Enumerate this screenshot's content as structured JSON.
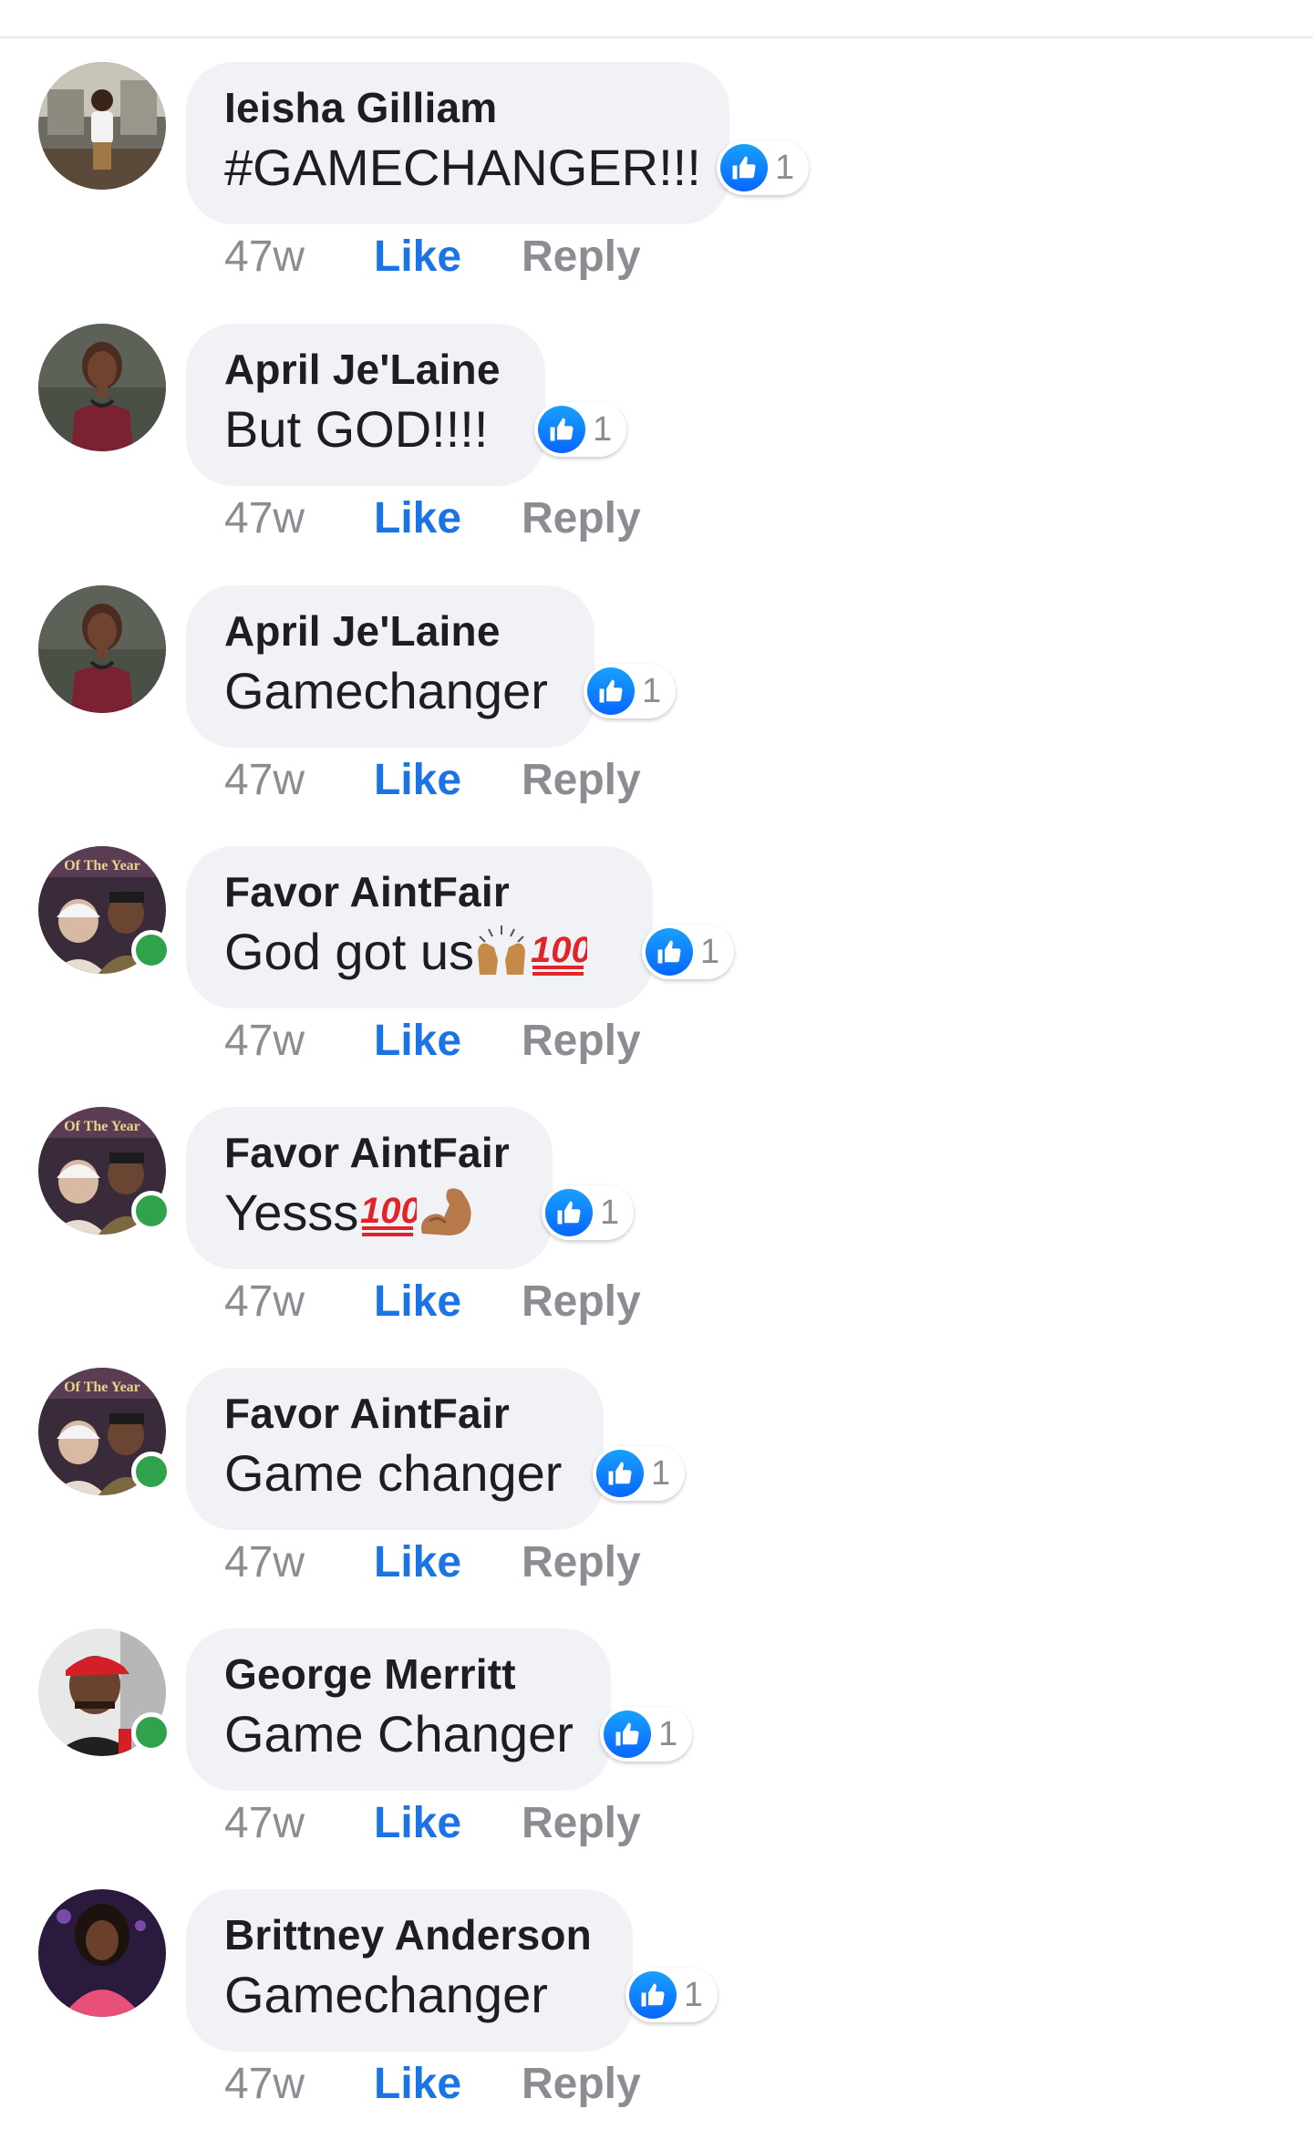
{
  "comments": [
    {
      "author": "Ieisha Gilliam",
      "text": "#GAMECHANGER!!!",
      "reaction_count": "1",
      "time": "47w",
      "like_label": "Like",
      "reply_label": "Reply",
      "online": false,
      "avatar_icon": "woman-standing-on-porch-photo"
    },
    {
      "author": "April Je'Laine",
      "text": "But GOD!!!!",
      "reaction_count": "1",
      "time": "47w",
      "like_label": "Like",
      "reply_label": "Reply",
      "online": false,
      "avatar_icon": "woman-portrait-photo"
    },
    {
      "author": "April Je'Laine",
      "text": "Gamechanger",
      "reaction_count": "1",
      "time": "47w",
      "like_label": "Like",
      "reply_label": "Reply",
      "online": false,
      "avatar_icon": "woman-portrait-photo"
    },
    {
      "author": "Favor AintFair",
      "text": "God got us",
      "text_emojis": [
        "raising-hands-emoji",
        "hundred-points-emoji"
      ],
      "reaction_count": "1",
      "time": "47w",
      "like_label": "Like",
      "reply_label": "Reply",
      "online": true,
      "avatar_icon": "couple-banner-photo",
      "avatar_banner_text": "Of The Year"
    },
    {
      "author": "Favor AintFair",
      "text": "Yesss",
      "text_emojis": [
        "hundred-points-emoji",
        "flexed-biceps-emoji"
      ],
      "reaction_count": "1",
      "time": "47w",
      "like_label": "Like",
      "reply_label": "Reply",
      "online": true,
      "avatar_icon": "couple-banner-photo",
      "avatar_banner_text": "Of The Year"
    },
    {
      "author": "Favor AintFair",
      "text": "Game changer",
      "reaction_count": "1",
      "time": "47w",
      "like_label": "Like",
      "reply_label": "Reply",
      "online": true,
      "avatar_icon": "couple-banner-photo",
      "avatar_banner_text": "Of The Year"
    },
    {
      "author": "George Merritt",
      "text": "Game Changer",
      "reaction_count": "1",
      "time": "47w",
      "like_label": "Like",
      "reply_label": "Reply",
      "online": true,
      "avatar_icon": "man-red-cap-photo"
    },
    {
      "author": "Brittney Anderson",
      "text": "Gamechanger",
      "reaction_count": "1",
      "time": "47w",
      "like_label": "Like",
      "reply_label": "Reply",
      "online": false,
      "avatar_icon": "woman-pink-outfit-photo"
    }
  ],
  "colors": {
    "bubble_bg": "#f0f2f5",
    "link_blue": "#1b74e4",
    "meta_gray": "#8a8d91",
    "online_green": "#31a24c",
    "like_icon_blue": "#0866ff"
  }
}
